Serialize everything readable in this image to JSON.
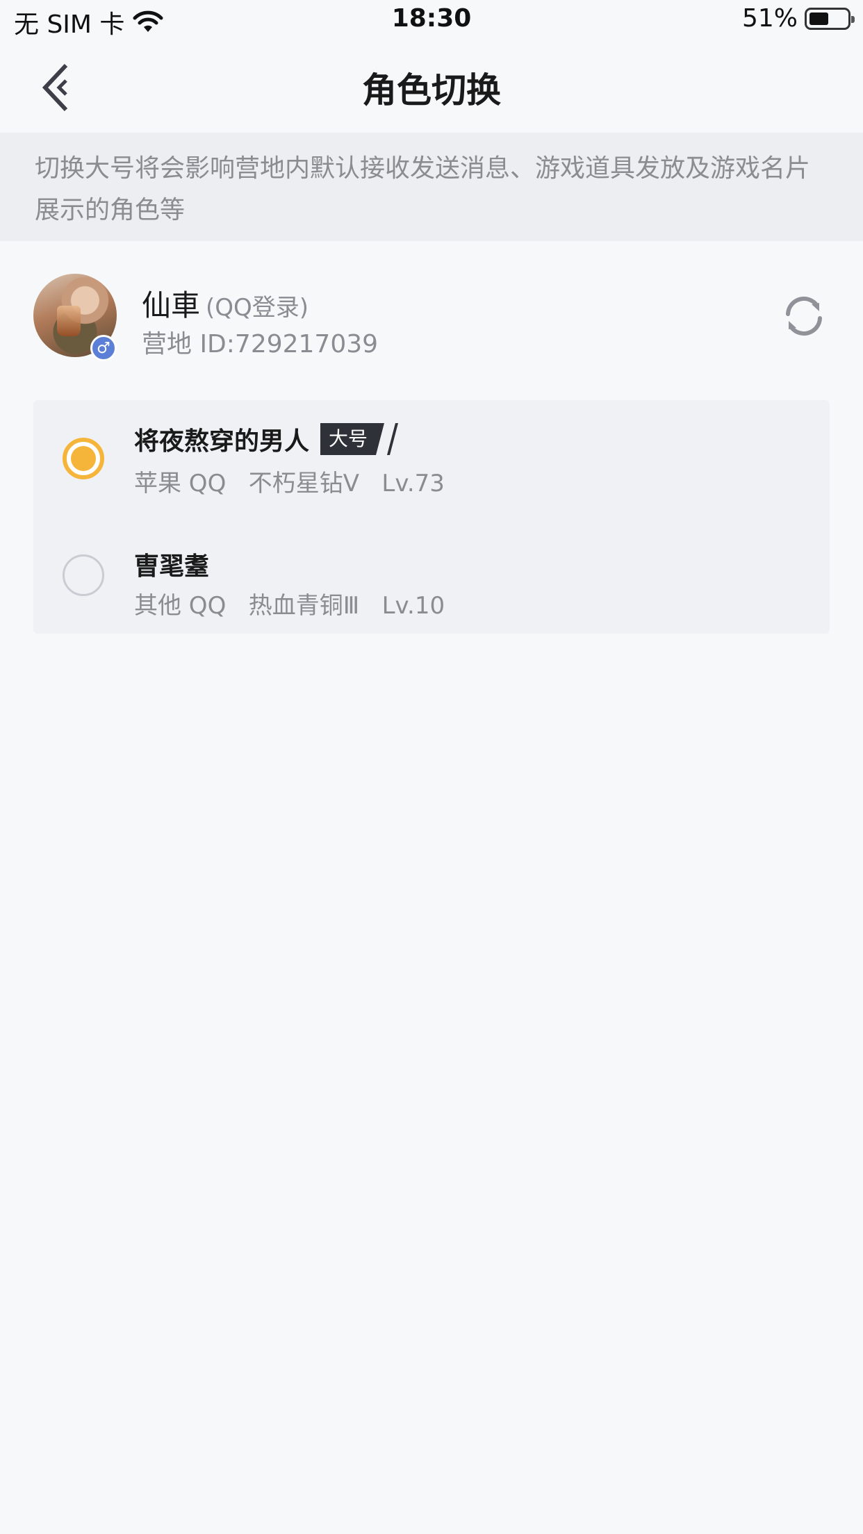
{
  "status_bar": {
    "carrier": "无 SIM 卡",
    "time": "18:30",
    "battery_percent": "51%",
    "battery_level": 0.51
  },
  "nav": {
    "title": "角色切换",
    "back_icon": "chevron-left-icon"
  },
  "notice": {
    "text": "切换大号将会影响营地内默认接收发送消息、游戏道具发放及游戏名片展示的角色等"
  },
  "profile": {
    "name": "仙車",
    "login_type": "(QQ登录)",
    "camp_id": "营地 ID:729217039",
    "gender_icon": "male-icon",
    "gender_symbol": "♂",
    "refresh_icon": "refresh-icon"
  },
  "roles": [
    {
      "name": "将夜熬穿的男人",
      "tag": "大号",
      "meta": "苹果 QQ   不朽星钻Ⅴ   Lv.73",
      "selected": true
    },
    {
      "name": "曺毣耋",
      "tag": "",
      "meta": "其他 QQ   热血青铜Ⅲ   Lv.10",
      "selected": false
    }
  ],
  "colors": {
    "accent": "#f5b53a",
    "background": "#f7f8fa",
    "notice_bg": "#eceef1",
    "card_bg": "#eff1f5",
    "tag_bg": "#2f3138",
    "gender_badge": "#5b7fd6"
  }
}
